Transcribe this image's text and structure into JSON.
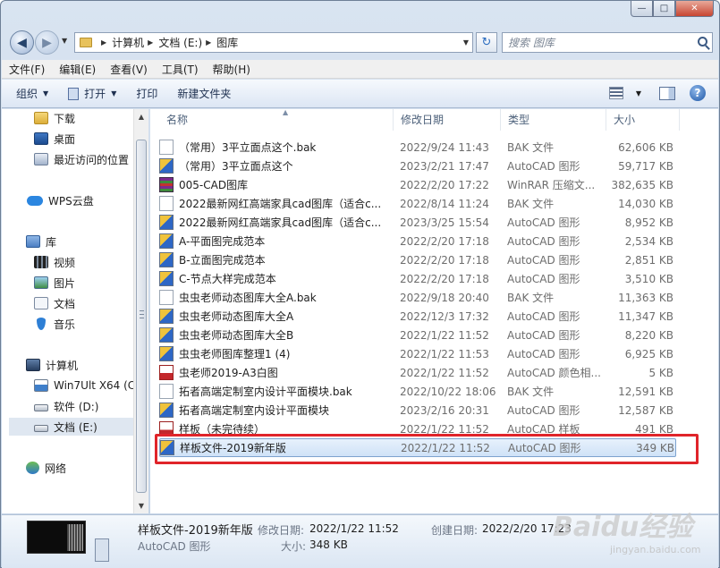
{
  "window": {
    "buttons": {
      "minimize": "—",
      "maximize": "□",
      "close": "✕"
    }
  },
  "nav": {
    "back": "◀",
    "forward": "▶",
    "breadcrumb": [
      "计算机",
      "文档 (E:)",
      "图库"
    ],
    "refresh": "↻",
    "search_placeholder": "搜索 图库"
  },
  "menu": [
    "文件(F)",
    "编辑(E)",
    "查看(V)",
    "工具(T)",
    "帮助(H)"
  ],
  "toolbar": {
    "organize": "组织",
    "open": "打开",
    "print": "打印",
    "new_folder": "新建文件夹",
    "help": "?"
  },
  "sidebar": {
    "items": [
      {
        "label": "下载",
        "icon": "folder-icon"
      },
      {
        "label": "桌面",
        "icon": "desktop-icon"
      },
      {
        "label": "最近访问的位置",
        "icon": "recent-places-icon"
      },
      {
        "label": "WPS云盘",
        "icon": "cloud-icon"
      },
      {
        "label": "库",
        "icon": "library-icon"
      },
      {
        "label": "视频",
        "icon": "video-icon"
      },
      {
        "label": "图片",
        "icon": "pictures-icon"
      },
      {
        "label": "文档",
        "icon": "documents-icon"
      },
      {
        "label": "音乐",
        "icon": "music-icon"
      },
      {
        "label": "计算机",
        "icon": "computer-icon"
      },
      {
        "label": "Win7Ult X64 (C:",
        "icon": "system-drive-icon"
      },
      {
        "label": "软件 (D:)",
        "icon": "drive-icon"
      },
      {
        "label": "文档 (E:)",
        "icon": "drive-icon"
      },
      {
        "label": "网络",
        "icon": "network-icon"
      }
    ]
  },
  "columns": {
    "name": "名称",
    "date": "修改日期",
    "type": "类型",
    "size": "大小"
  },
  "files": [
    {
      "name": "（常用）3平立面点这个.bak",
      "date": "2022/9/24 11:43",
      "type": "BAK 文件",
      "size": "62,606 KB",
      "icon": "bak"
    },
    {
      "name": "（常用）3平立面点这个",
      "date": "2023/2/21 17:47",
      "type": "AutoCAD 图形",
      "size": "59,717 KB",
      "icon": "dwg"
    },
    {
      "name": "005-CAD图库",
      "date": "2022/2/20 17:22",
      "type": "WinRAR 压缩文...",
      "size": "382,635 KB",
      "icon": "rar"
    },
    {
      "name": "2022最新网红高端家具cad图库（适合c...",
      "date": "2022/8/14 11:24",
      "type": "BAK 文件",
      "size": "14,030 KB",
      "icon": "bak"
    },
    {
      "name": "2022最新网红高端家具cad图库（适合c...",
      "date": "2023/3/25 15:54",
      "type": "AutoCAD 图形",
      "size": "8,952 KB",
      "icon": "dwg"
    },
    {
      "name": "A-平面图完成范本",
      "date": "2022/2/20 17:18",
      "type": "AutoCAD 图形",
      "size": "2,534 KB",
      "icon": "dwg"
    },
    {
      "name": "B-立面图完成范本",
      "date": "2022/2/20 17:18",
      "type": "AutoCAD 图形",
      "size": "2,851 KB",
      "icon": "dwg"
    },
    {
      "name": "C-节点大样完成范本",
      "date": "2022/2/20 17:18",
      "type": "AutoCAD 图形",
      "size": "3,510 KB",
      "icon": "dwg"
    },
    {
      "name": "虫虫老师动态图库大全A.bak",
      "date": "2022/9/18 20:40",
      "type": "BAK 文件",
      "size": "11,363 KB",
      "icon": "bak"
    },
    {
      "name": "虫虫老师动态图库大全A",
      "date": "2022/12/3 17:32",
      "type": "AutoCAD 图形",
      "size": "11,347 KB",
      "icon": "dwg"
    },
    {
      "name": "虫虫老师动态图库大全B",
      "date": "2022/1/22 11:52",
      "type": "AutoCAD 图形",
      "size": "8,220 KB",
      "icon": "dwg"
    },
    {
      "name": "虫虫老师图库整理1 (4)",
      "date": "2022/1/22 11:53",
      "type": "AutoCAD 图形",
      "size": "6,925 KB",
      "icon": "dwg"
    },
    {
      "name": "虫老师2019-A3白图",
      "date": "2022/1/22 11:52",
      "type": "AutoCAD 颜色相...",
      "size": "5 KB",
      "icon": "ctb"
    },
    {
      "name": "拓者高端定制室内设计平面模块.bak",
      "date": "2022/10/22 18:06",
      "type": "BAK 文件",
      "size": "12,591 KB",
      "icon": "bak"
    },
    {
      "name": "拓者高端定制室内设计平面模块",
      "date": "2023/2/16 20:31",
      "type": "AutoCAD 图形",
      "size": "12,587 KB",
      "icon": "dwg"
    },
    {
      "name": "样板（未完待续）",
      "date": "2022/1/22 11:52",
      "type": "AutoCAD 样板",
      "size": "491 KB",
      "icon": "dwt"
    },
    {
      "name": "样板文件-2019新年版",
      "date": "2022/1/22 11:52",
      "type": "AutoCAD 图形",
      "size": "349 KB",
      "icon": "dwg"
    }
  ],
  "details": {
    "name": "样板文件-2019新年版",
    "type": "AutoCAD 图形",
    "modified_label": "修改日期:",
    "modified": "2022/1/22 11:52",
    "created_label": "创建日期:",
    "created": "2022/2/20 17:23",
    "size_label": "大小:",
    "size": "348 KB"
  },
  "watermark": {
    "main": "Baidu经验",
    "sub": "jingyan.baidu.com"
  }
}
